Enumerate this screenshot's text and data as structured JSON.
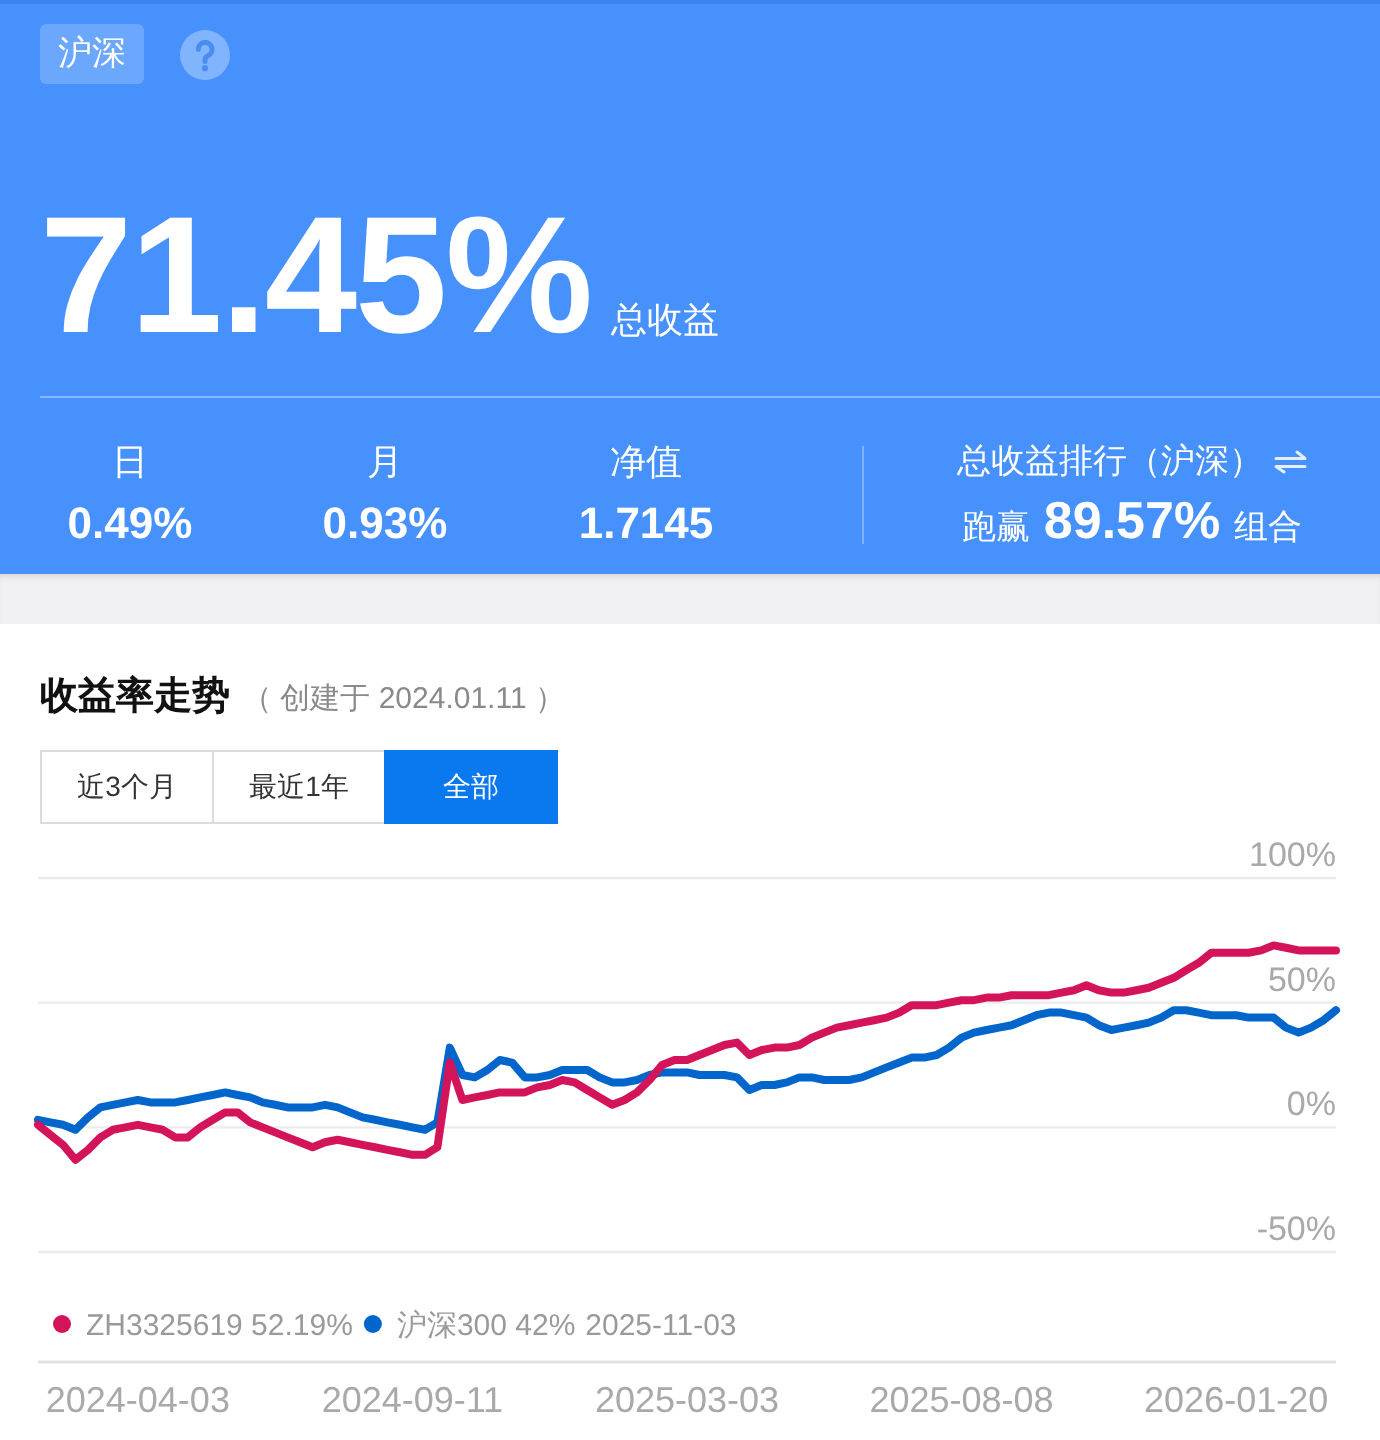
{
  "header": {
    "market_tag": "沪深",
    "total_return": {
      "value": "71.45%",
      "label": "总收益"
    },
    "stats": [
      {
        "label": "日",
        "value": "0.49%"
      },
      {
        "label": "月",
        "value": "0.93%"
      },
      {
        "label": "净值",
        "value": "1.7145"
      }
    ],
    "ranking": {
      "title": "总收益排行（沪深）",
      "prefix": "跑赢",
      "value": "89.57%",
      "suffix": "组合"
    }
  },
  "chart": {
    "title": "收益率走势",
    "subtitle": "（ 创建于 2024.01.11 ）",
    "tabs": [
      {
        "label": "近3个月",
        "selected": false
      },
      {
        "label": "最近1年",
        "selected": false
      },
      {
        "label": "全部",
        "selected": true
      }
    ],
    "legend": [
      {
        "value": "52.19%"
      },
      {
        "value": "42%"
      }
    ],
    "legend_date": "2025-11-03",
    "chart_data": {
      "type": "line",
      "categories": [
        null,
        null,
        null,
        null,
        null,
        null,
        null,
        null,
        "2024-04-03",
        null,
        null,
        null,
        null,
        null,
        null,
        null,
        null,
        null,
        null,
        null,
        null,
        null,
        null,
        null,
        null,
        null,
        null,
        null,
        null,
        null,
        "2024-09-11",
        null,
        null,
        null,
        null,
        null,
        null,
        null,
        null,
        null,
        null,
        null,
        null,
        null,
        null,
        null,
        null,
        null,
        null,
        null,
        null,
        null,
        "2025-03-03",
        null,
        null,
        null,
        null,
        null,
        null,
        null,
        null,
        null,
        null,
        null,
        null,
        null,
        null,
        null,
        null,
        null,
        null,
        null,
        null,
        null,
        "2025-08-08",
        null,
        null,
        null,
        null,
        null,
        null,
        null,
        null,
        null,
        null,
        null,
        null,
        null,
        null,
        null,
        null,
        null,
        null,
        null,
        null,
        null,
        "2026-01-20",
        null,
        null,
        null,
        null,
        null,
        null,
        null,
        null
      ],
      "series": [
        {
          "name": "ZH3325619",
          "color": "#d4145a",
          "values": [
            1,
            -3,
            -7,
            -13,
            -9,
            -4,
            -1,
            0,
            1,
            0,
            -1,
            -4,
            -4,
            0,
            3,
            6,
            6,
            2,
            0,
            -2,
            -4,
            -6,
            -8,
            -6,
            -5,
            -6,
            -7,
            -8,
            -9,
            -10,
            -11,
            -11,
            -8,
            26,
            11,
            12,
            13,
            14,
            14,
            14,
            16,
            17,
            19,
            18,
            15,
            12,
            9,
            11,
            14,
            19,
            25,
            27,
            27,
            29,
            31,
            33,
            34,
            29,
            31,
            32,
            32,
            33,
            36,
            38,
            40,
            41,
            42,
            43,
            44,
            46,
            49,
            49,
            49,
            50,
            51,
            51,
            52,
            52,
            53,
            53,
            53,
            53,
            54,
            55,
            57,
            55,
            54,
            54,
            55,
            56,
            58,
            60,
            63,
            66,
            70,
            70,
            70,
            70,
            71,
            73,
            72,
            71,
            71,
            71,
            71
          ]
        },
        {
          "name": "沪深300",
          "color": "#0066cc",
          "values": [
            3,
            2,
            1,
            -1,
            4,
            8,
            9,
            10,
            11,
            10,
            10,
            10,
            11,
            12,
            13,
            14,
            13,
            12,
            10,
            9,
            8,
            8,
            8,
            9,
            8,
            6,
            4,
            3,
            2,
            1,
            0,
            -1,
            2,
            32,
            21,
            20,
            23,
            27,
            26,
            20,
            20,
            21,
            23,
            23,
            23,
            20,
            18,
            18,
            19,
            21,
            22,
            22,
            22,
            21,
            21,
            21,
            20,
            15,
            17,
            17,
            18,
            20,
            20,
            19,
            19,
            19,
            20,
            22,
            24,
            26,
            28,
            28,
            29,
            32,
            36,
            38,
            39,
            40,
            41,
            43,
            45,
            46,
            46,
            45,
            44,
            41,
            39,
            40,
            41,
            42,
            44,
            47,
            47,
            46,
            45,
            45,
            45,
            44,
            44,
            44,
            40,
            38,
            40,
            43,
            47
          ]
        }
      ],
      "ylim": [
        -50,
        100
      ],
      "yticks": [
        {
          "value": -50,
          "label": "-50%"
        },
        {
          "value": 0,
          "label": "0%"
        },
        {
          "value": 50,
          "label": "50%"
        },
        {
          "value": 100,
          "label": "100%"
        }
      ]
    }
  }
}
